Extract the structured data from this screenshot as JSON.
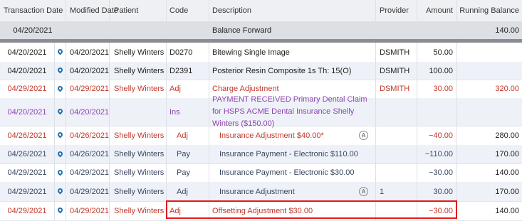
{
  "headers": {
    "transaction_date": "Transaction Date",
    "modified_date": "Modified Date",
    "patient": "Patient",
    "code": "Code",
    "description": "Description",
    "provider": "Provider",
    "amount": "Amount",
    "running_balance": "Running Balance"
  },
  "balance_forward": {
    "date": "04/20/2021",
    "description": "Balance Forward",
    "running_balance": "140.00"
  },
  "rows": [
    {
      "tdate": "04/20/2021",
      "mdate": "04/20/2021",
      "patient": "Shelly Winters",
      "code": "D0270",
      "description": "Bitewing Single Image",
      "provider": "DSMITH",
      "amount": "50.00",
      "balance": ""
    },
    {
      "tdate": "04/20/2021",
      "mdate": "04/20/2021",
      "patient": "Shelly Winters",
      "code": "D2391",
      "description": "Posterior Resin Composite 1s Th: 15(O)",
      "provider": "DSMITH",
      "amount": "100.00",
      "balance": ""
    },
    {
      "tdate": "04/29/2021",
      "mdate": "04/29/2021",
      "patient": "Shelly Winters",
      "code": "Adj",
      "description": "Charge Adjustment",
      "provider": "DSMITH",
      "amount": "30.00",
      "balance": "320.00"
    },
    {
      "tdate": "04/20/2021",
      "mdate": "04/20/2021",
      "patient": "",
      "code": "Ins",
      "description": "PAYMENT RECEIVED Primary Dental Claim for HSPS ACME Dental Insurance Shelly Winters ($150.00)",
      "provider": "",
      "amount": "",
      "balance": ""
    },
    {
      "tdate": "04/26/2021",
      "mdate": "04/26/2021",
      "patient": "Shelly Winters",
      "code": "Adj",
      "description": "Insurance Adjustment $40.00*",
      "provider": "",
      "amount": "−40.00",
      "balance": "280.00"
    },
    {
      "tdate": "04/26/2021",
      "mdate": "04/26/2021",
      "patient": "Shelly Winters",
      "code": "Pay",
      "description": "Insurance Payment - Electronic $110.00",
      "provider": "",
      "amount": "−110.00",
      "balance": "170.00"
    },
    {
      "tdate": "04/29/2021",
      "mdate": "04/29/2021",
      "patient": "Shelly Winters",
      "code": "Pay",
      "description": "Insurance Payment - Electronic $30.00",
      "provider": "",
      "amount": "−30.00",
      "balance": "140.00"
    },
    {
      "tdate": "04/29/2021",
      "mdate": "04/29/2021",
      "patient": "Shelly Winters",
      "code": "Adj",
      "description": "Insurance Adjustment",
      "provider": "1",
      "amount": "30.00",
      "balance": "170.00"
    },
    {
      "tdate": "04/29/2021",
      "mdate": "04/29/2021",
      "patient": "Shelly Winters",
      "code": "Adj",
      "description": "Offsetting Adjustment $30.00",
      "provider": "",
      "amount": "−30.00",
      "balance": "140.00"
    }
  ],
  "badge_letter": "A",
  "colors": {
    "red": "#c0392b",
    "purple": "#8e44ad",
    "pin": "#1f6fae",
    "highlight": "#e21b1b"
  }
}
